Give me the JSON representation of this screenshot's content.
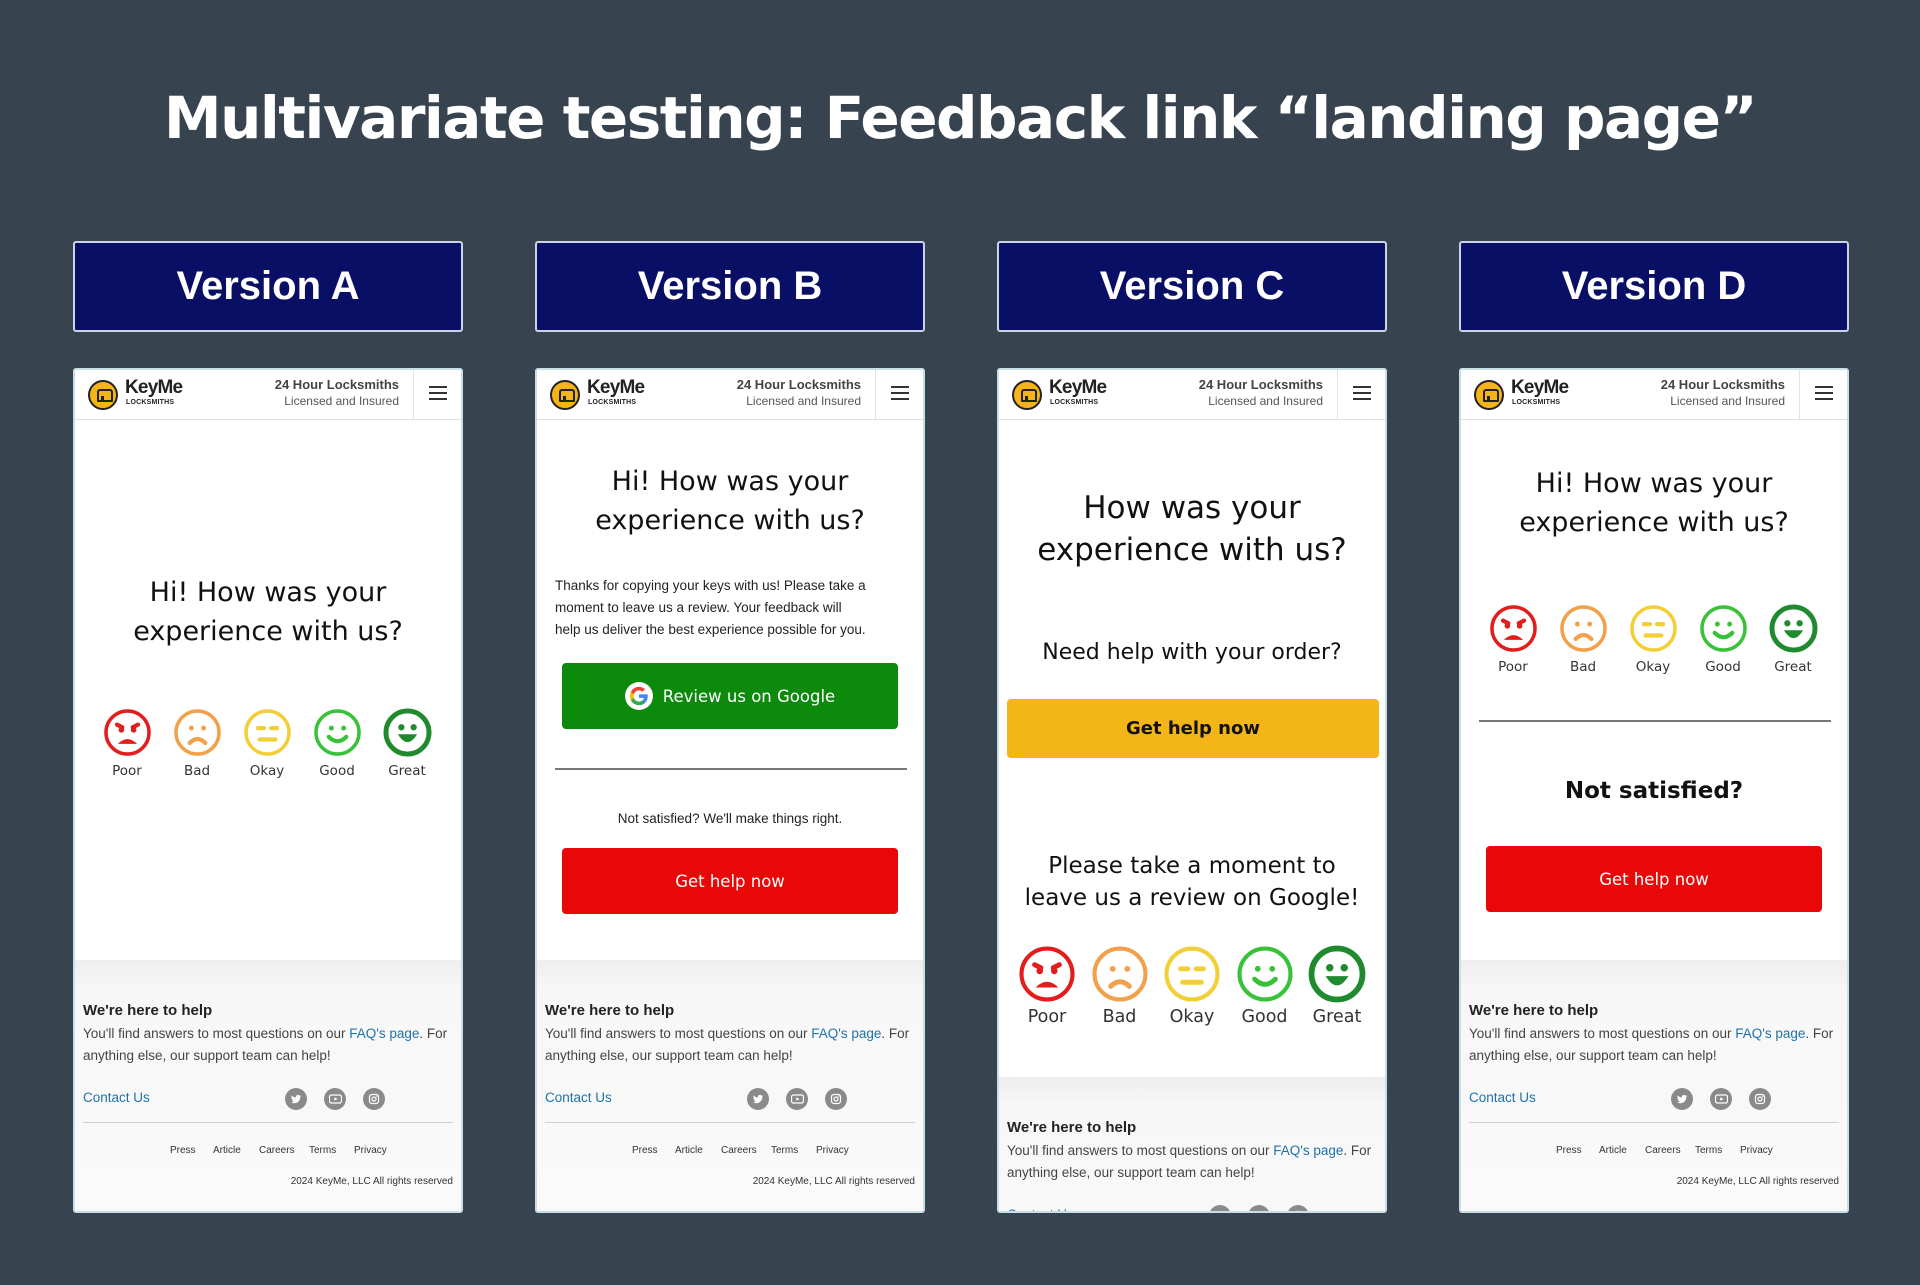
{
  "title": "Multivariate testing: Feedback link “landing page”",
  "colors": {
    "background": "#37444f",
    "version_label_bg": "#0a0f66",
    "poor": "#e31c1c",
    "bad": "#f2a14a",
    "okay": "#f2cf36",
    "good": "#39c239",
    "great": "#1f8a2e",
    "primary_red": "#e80808",
    "google_green": "#0c8a0c",
    "help_yellow": "#f4b516",
    "link_blue": "#1e72a8"
  },
  "header": {
    "logo_text": "KeyMe",
    "logo_sub": "LOCKSMITHS",
    "title": "24 Hour Locksmiths",
    "subtitle": "Licensed and Insured",
    "menu_icon": "hamburger-menu-icon"
  },
  "ratings": [
    {
      "label": "Poor",
      "icon": "angry-face-icon"
    },
    {
      "label": "Bad",
      "icon": "frown-face-icon"
    },
    {
      "label": "Okay",
      "icon": "neutral-face-icon"
    },
    {
      "label": "Good",
      "icon": "smile-face-icon"
    },
    {
      "label": "Great",
      "icon": "grin-face-icon"
    }
  ],
  "footer": {
    "title": "We're here to help",
    "text_before": "You'll find answers to most questions on our ",
    "faq_link": "FAQ's page",
    "text_after": ". For anything else, our support team can help!",
    "contact": "Contact Us",
    "social_icons": [
      "twitter-icon",
      "youtube-icon",
      "instagram-icon"
    ],
    "nav": [
      "Press",
      "Article",
      "Careers",
      "Terms",
      "Privacy"
    ],
    "copyright": "2024 KeyMe, LLC All rights reserved"
  },
  "versions": [
    {
      "label": "Version A",
      "heading": "Hi! How was your\nexperience with us?"
    },
    {
      "label": "Version B",
      "heading": "Hi! How was your\nexperience with us?",
      "body": "Thanks for copying your keys with us! Please take a\nmoment to leave us a review. Your feedback will\nhelp us deliver the best experience possible for you.",
      "google_button": "Review us on Google",
      "not_satisfied": "Not satisfied? We'll make things right.",
      "help_button": "Get help now"
    },
    {
      "label": "Version C",
      "heading": "How was your\nexperience with us?",
      "question": "Need help with your order?",
      "help_button": "Get help now",
      "review_prompt": "Please take a moment to\nleave us a review on Google!"
    },
    {
      "label": "Version D",
      "heading": "Hi! How was your\nexperience with us?",
      "not_satisfied": "Not satisfied?",
      "help_button": "Get help now"
    }
  ]
}
